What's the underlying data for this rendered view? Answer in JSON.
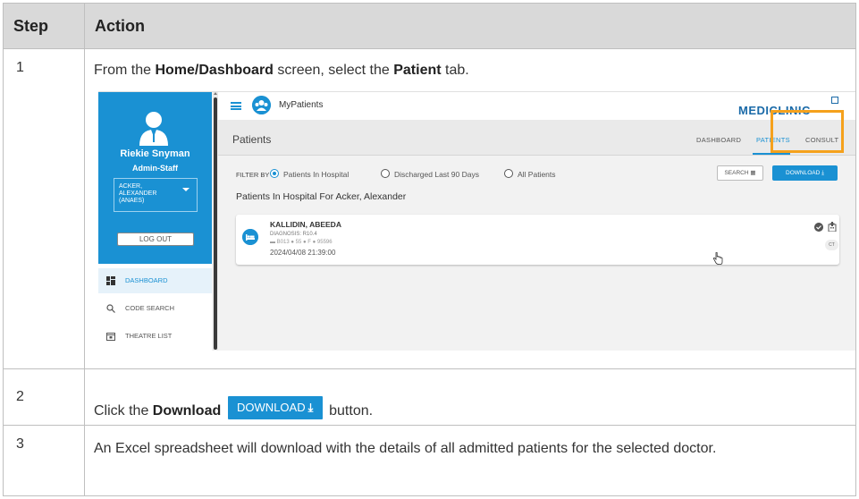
{
  "table": {
    "header": {
      "step": "Step",
      "action": "Action"
    },
    "rows": [
      {
        "step": "1",
        "text_pre": "From the ",
        "bold1": "Home/Dashboard",
        "text_mid": " screen, select the ",
        "bold2": "Patient",
        "text_post": " tab."
      },
      {
        "step": "2",
        "text_pre": "Click the ",
        "bold1": "Download",
        "button_label": "DOWNLOAD",
        "text_post": " button."
      },
      {
        "step": "3",
        "text": "An Excel spreadsheet will download with the details of all admitted patients for the selected doctor."
      }
    ]
  },
  "screenshot": {
    "sidebar": {
      "user_name": "Riekie Snyman",
      "user_role": "Admin-Staff",
      "doctor_select_lines": [
        "ACKER,",
        "ALEXANDER",
        "(ANAES)"
      ],
      "logout_label": "LOG OUT",
      "nav": [
        {
          "label": "DASHBOARD",
          "icon": "dashboard-icon",
          "active": true
        },
        {
          "label": "CODE SEARCH",
          "icon": "search-icon",
          "active": false
        },
        {
          "label": "THEATRE LIST",
          "icon": "calendar-icon",
          "active": false
        }
      ]
    },
    "appbar": {
      "title": "MyPatients",
      "brand": "MEDICLINIC"
    },
    "subbar": {
      "title": "Patients",
      "tabs": [
        "DASHBOARD",
        "PATIENTS",
        "CONSULT"
      ],
      "active_tab": "PATIENTS"
    },
    "filter": {
      "label": "FILTER BY",
      "options": [
        "Patients In Hospital",
        "Discharged Last 90 Days",
        "All Patients"
      ],
      "selected": "Patients In Hospital",
      "search_label": "SEARCH",
      "download_label": "DOWNLOAD"
    },
    "list_header": "Patients In Hospital For Acker, Alexander",
    "patient": {
      "name": "KALLIDIN, ABEEDA",
      "diagnosis": "DIAGNOSIS: R10.4",
      "meta": "B013 ● 55 ● F ● 95596",
      "datetime": "2024/04/08 21:39:00",
      "badge": "CT"
    },
    "colors": {
      "primary": "#1a91d3",
      "highlight": "#f5a11c",
      "brand": "#1a6aa8"
    }
  }
}
